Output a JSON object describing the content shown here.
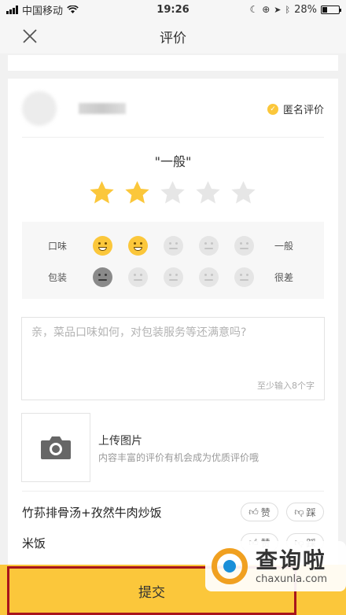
{
  "status_bar": {
    "carrier": "中国移动",
    "time": "19:26",
    "battery": "28%",
    "battery_level": 0.28
  },
  "header": {
    "title": "评价"
  },
  "shop": {
    "anonymous_label": "匿名评价"
  },
  "rating": {
    "label": "\"一般\"",
    "stars": 2,
    "max_stars": 5
  },
  "sub_ratings": [
    {
      "label": "口味",
      "value_text": "一般",
      "faces": [
        "happy",
        "happy",
        "grey",
        "grey",
        "grey"
      ]
    },
    {
      "label": "包装",
      "value_text": "很差",
      "faces": [
        "dark",
        "grey",
        "grey",
        "grey",
        "grey"
      ]
    }
  ],
  "comment": {
    "placeholder": "亲，菜品口味如何，对包装服务等还满意吗?",
    "value": "",
    "hint": "至少输入8个字"
  },
  "upload": {
    "title": "上传图片",
    "subtitle": "内容丰富的评价有机会成为优质评价哦"
  },
  "dishes": [
    {
      "name": "竹荪排骨汤+孜然牛肉炒饭",
      "like_label": "赞",
      "dislike_label": "踩"
    },
    {
      "name": "米饭",
      "like_label": "赞",
      "dislike_label": "踩"
    }
  ],
  "submit": {
    "label": "提交"
  },
  "watermark": {
    "brand": "查询啦",
    "domain": "chaxunla.com"
  },
  "colors": {
    "accent": "#fbc73b",
    "highlight_border": "#a8151c",
    "star_empty": "#e6e6e6"
  },
  "icons": {
    "close": "close-icon",
    "camera": "camera-icon",
    "thumb_up": "thumb-up-icon",
    "thumb_down": "thumb-down-icon"
  }
}
